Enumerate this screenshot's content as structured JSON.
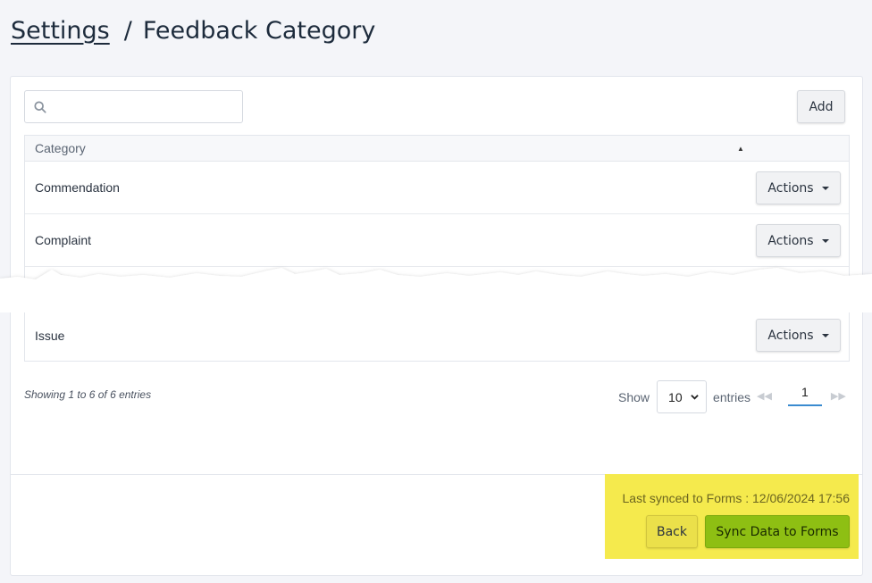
{
  "breadcrumb": {
    "parent": "Settings",
    "separator": "/",
    "current": "Feedback Category"
  },
  "toolbar": {
    "search_placeholder": "",
    "add_label": "Add"
  },
  "table": {
    "column_header": "Category",
    "rows": [
      {
        "category": "Commendation",
        "action_label": "Actions"
      },
      {
        "category": "Complaint",
        "action_label": "Actions"
      },
      {
        "category": "Issue",
        "action_label": "Actions"
      }
    ]
  },
  "footer": {
    "info": "Showing 1 to 6 of 6 entries",
    "show_label": "Show",
    "page_length": "10",
    "entries_label": "entries",
    "current_page": "1"
  },
  "sync": {
    "last_synced": "Last synced to Forms : 12/06/2024 17:56",
    "back_label": "Back",
    "sync_label": "Sync Data to Forms"
  },
  "icons": {
    "search": "search-icon",
    "sort": "sort-ascending-icon",
    "caret": "caret-down-icon",
    "prev": "previous-page-icon",
    "next": "next-page-icon"
  },
  "colors": {
    "highlight": "#f5ea4d",
    "sync_button": "#8ebf13",
    "pagination_active": "#3a8bd0"
  }
}
